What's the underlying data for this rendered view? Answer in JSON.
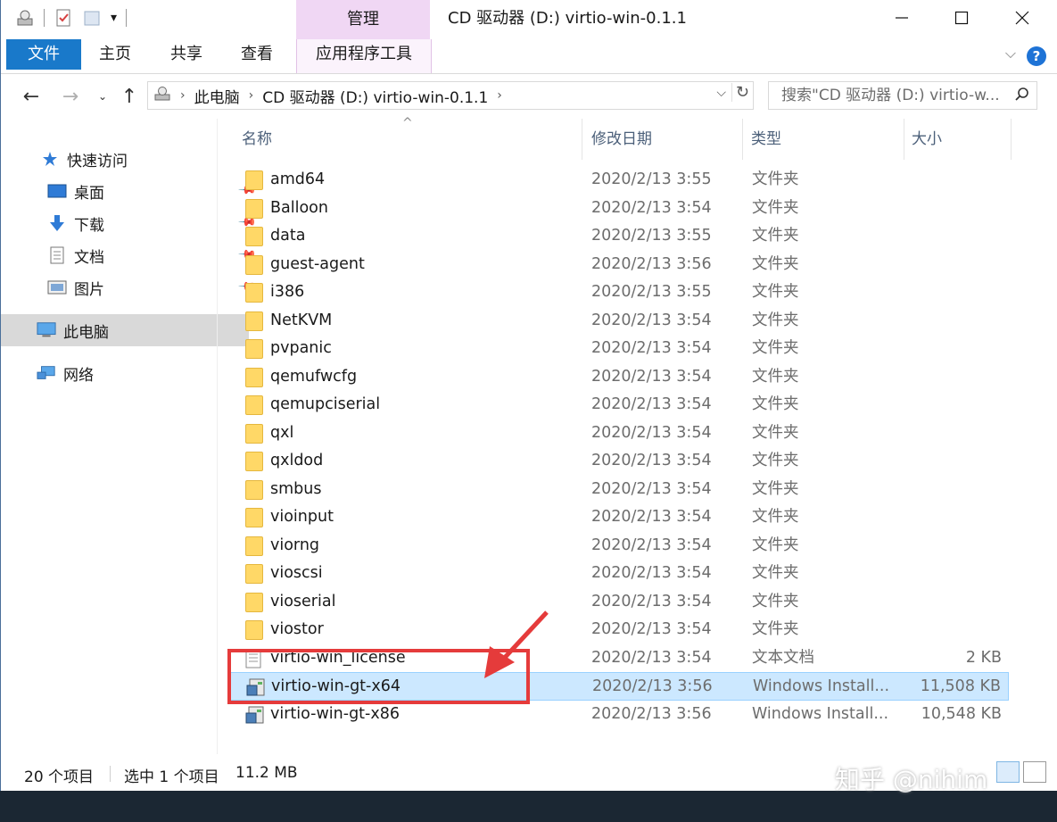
{
  "window": {
    "title": "CD 驱动器 (D:) virtio-win-0.1.1",
    "manage_tab": "管理",
    "controls": {
      "minimize": "—",
      "maximize": "☐",
      "close": "✕"
    }
  },
  "ribbon": {
    "tabs": [
      "文件",
      "主页",
      "共享",
      "查看",
      "应用程序工具"
    ],
    "help": "?"
  },
  "address": {
    "crumbs": [
      "此电脑",
      "CD 驱动器 (D:) virtio-win-0.1.1"
    ],
    "search_placeholder": "搜索\"CD 驱动器 (D:) virtio-w..."
  },
  "nav": {
    "quick_access": "快速访问",
    "pinned": [
      "桌面",
      "下载",
      "文档",
      "图片"
    ],
    "this_pc": "此电脑",
    "network": "网络"
  },
  "columns": {
    "name": "名称",
    "date": "修改日期",
    "type": "类型",
    "size": "大小"
  },
  "files": [
    {
      "name": "amd64",
      "date": "2020/2/13 3:55",
      "type": "文件夹",
      "size": "",
      "kind": "folder"
    },
    {
      "name": "Balloon",
      "date": "2020/2/13 3:54",
      "type": "文件夹",
      "size": "",
      "kind": "folder"
    },
    {
      "name": "data",
      "date": "2020/2/13 3:55",
      "type": "文件夹",
      "size": "",
      "kind": "folder"
    },
    {
      "name": "guest-agent",
      "date": "2020/2/13 3:56",
      "type": "文件夹",
      "size": "",
      "kind": "folder"
    },
    {
      "name": "i386",
      "date": "2020/2/13 3:55",
      "type": "文件夹",
      "size": "",
      "kind": "folder"
    },
    {
      "name": "NetKVM",
      "date": "2020/2/13 3:54",
      "type": "文件夹",
      "size": "",
      "kind": "folder"
    },
    {
      "name": "pvpanic",
      "date": "2020/2/13 3:54",
      "type": "文件夹",
      "size": "",
      "kind": "folder"
    },
    {
      "name": "qemufwcfg",
      "date": "2020/2/13 3:54",
      "type": "文件夹",
      "size": "",
      "kind": "folder"
    },
    {
      "name": "qemupciserial",
      "date": "2020/2/13 3:54",
      "type": "文件夹",
      "size": "",
      "kind": "folder"
    },
    {
      "name": "qxl",
      "date": "2020/2/13 3:54",
      "type": "文件夹",
      "size": "",
      "kind": "folder"
    },
    {
      "name": "qxldod",
      "date": "2020/2/13 3:54",
      "type": "文件夹",
      "size": "",
      "kind": "folder"
    },
    {
      "name": "smbus",
      "date": "2020/2/13 3:54",
      "type": "文件夹",
      "size": "",
      "kind": "folder"
    },
    {
      "name": "vioinput",
      "date": "2020/2/13 3:54",
      "type": "文件夹",
      "size": "",
      "kind": "folder"
    },
    {
      "name": "viorng",
      "date": "2020/2/13 3:54",
      "type": "文件夹",
      "size": "",
      "kind": "folder"
    },
    {
      "name": "vioscsi",
      "date": "2020/2/13 3:54",
      "type": "文件夹",
      "size": "",
      "kind": "folder"
    },
    {
      "name": "vioserial",
      "date": "2020/2/13 3:54",
      "type": "文件夹",
      "size": "",
      "kind": "folder"
    },
    {
      "name": "viostor",
      "date": "2020/2/13 3:54",
      "type": "文件夹",
      "size": "",
      "kind": "folder"
    },
    {
      "name": "virtio-win_license",
      "date": "2020/2/13 3:54",
      "type": "文本文档",
      "size": "2 KB",
      "kind": "text"
    },
    {
      "name": "virtio-win-gt-x64",
      "date": "2020/2/13 3:56",
      "type": "Windows Install...",
      "size": "11,508 KB",
      "kind": "msi",
      "selected": true
    },
    {
      "name": "virtio-win-gt-x86",
      "date": "2020/2/13 3:56",
      "type": "Windows Install...",
      "size": "10,548 KB",
      "kind": "msi"
    }
  ],
  "status": {
    "count": "20 个项目",
    "selected": "选中 1 个项目",
    "size": "11.2 MB"
  },
  "watermark": "知乎 @nihim",
  "colors": {
    "accent": "#1979ca",
    "manage": "#f0d7f4",
    "selection": "#cce8ff",
    "annotation": "#e53b3b",
    "folder": "#ffd867"
  }
}
